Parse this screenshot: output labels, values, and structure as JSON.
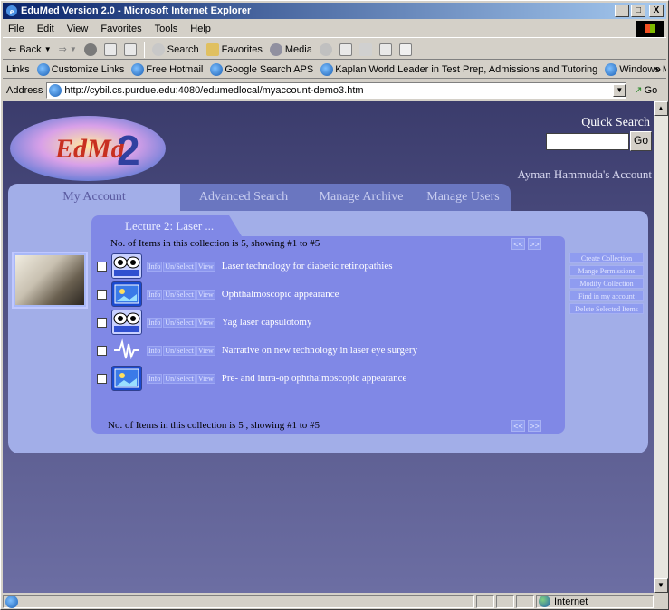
{
  "window": {
    "title": "EduMed Version 2.0 - Microsoft Internet Explorer",
    "minimize": "_",
    "maximize": "□",
    "close": "X"
  },
  "menu": [
    "File",
    "Edit",
    "View",
    "Favorites",
    "Tools",
    "Help"
  ],
  "toolbar": {
    "back": "Back",
    "search": "Search",
    "favorites": "Favorites",
    "media": "Media"
  },
  "links": {
    "label": "Links",
    "items": [
      "Customize Links",
      "Free Hotmail",
      "Google Search APS",
      "Kaplan World Leader in Test Prep, Admissions and Tutoring",
      "Windows Media"
    ],
    "overflow": "»"
  },
  "address": {
    "label": "Address",
    "url": "http://cybil.cs.purdue.edu:4080/edumedlocal/myaccount-demo3.htm",
    "go": "Go"
  },
  "page": {
    "logo_text": "EdMed 2",
    "quick_search_label": "Quick Search",
    "quick_search_button": "Go",
    "account_label": "Ayman Hammuda's Account",
    "tabs": [
      "My Account",
      "Advanced Search",
      "Manage Archive",
      "Manage Users"
    ],
    "collection_tab": "Lecture 2: Laser ...",
    "count_top": "No. of Items in this collection is 5, showing #1 to #5",
    "count_bottom": "No. of Items in this collection is 5 , showing #1 to #5",
    "pager_prev": "<<",
    "pager_next": ">>",
    "actions": [
      "Info",
      "Un/Select",
      "View"
    ],
    "items": [
      {
        "title": "Laser technology for diabetic retinopathies",
        "icon": "eye-video-icon"
      },
      {
        "title": "Ophthalmoscopic appearance",
        "icon": "image-icon"
      },
      {
        "title": "Yag laser capsulotomy",
        "icon": "eye-video-icon"
      },
      {
        "title": "Narrative on new technology in laser eye surgery",
        "icon": "audio-wave-icon"
      },
      {
        "title": "Pre- and intra-op ophthalmoscopic appearance",
        "icon": "image-icon"
      }
    ],
    "side_menu": [
      "Create Collection",
      "Mange Permissions",
      "Modify Collection",
      "Find in my account",
      "Delete Selected Items"
    ]
  },
  "status": {
    "zone": "Internet"
  },
  "colors": {
    "accent": "#8088e6",
    "panel": "#a2aee8",
    "background_top": "#3b3c6c"
  }
}
